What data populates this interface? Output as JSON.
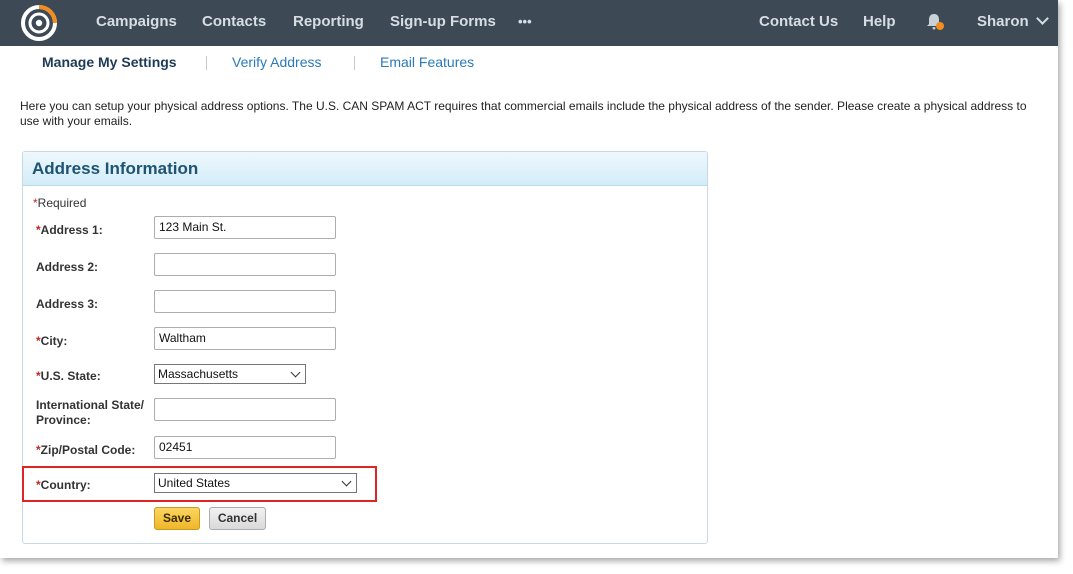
{
  "topnav": {
    "items": [
      "Campaigns",
      "Contacts",
      "Reporting",
      "Sign-up Forms"
    ],
    "more": "•••",
    "contact_us": "Contact Us",
    "help": "Help",
    "user": "Sharon"
  },
  "subnav": {
    "active": "Manage My Settings",
    "verify": "Verify Address",
    "features": "Email Features"
  },
  "intro": "Here you can setup your physical address options. The U.S. CAN SPAM ACT requires that commercial emails include the physical address of the sender. Please create a physical address to use with your emails.",
  "form": {
    "title": "Address Information",
    "required_note": "Required",
    "required_mark": "*",
    "address1": {
      "label": "Address 1:",
      "value": "123 Main St."
    },
    "address2": {
      "label": "Address 2:",
      "value": ""
    },
    "address3": {
      "label": "Address 3:",
      "value": ""
    },
    "city": {
      "label": "City:",
      "value": "Waltham"
    },
    "state": {
      "label": "U.S. State:",
      "value": "Massachusetts"
    },
    "intl_state": {
      "label_line1": "International State/",
      "label_line2": "Province:",
      "value": ""
    },
    "zip": {
      "label": "Zip/Postal Code:",
      "value": "02451"
    },
    "country": {
      "label": "Country:",
      "value": "United States"
    },
    "save": "Save",
    "cancel": "Cancel"
  },
  "colors": {
    "topbar": "#3d4a55",
    "accent_orange": "#f58c1e",
    "highlight": "#e02424"
  }
}
